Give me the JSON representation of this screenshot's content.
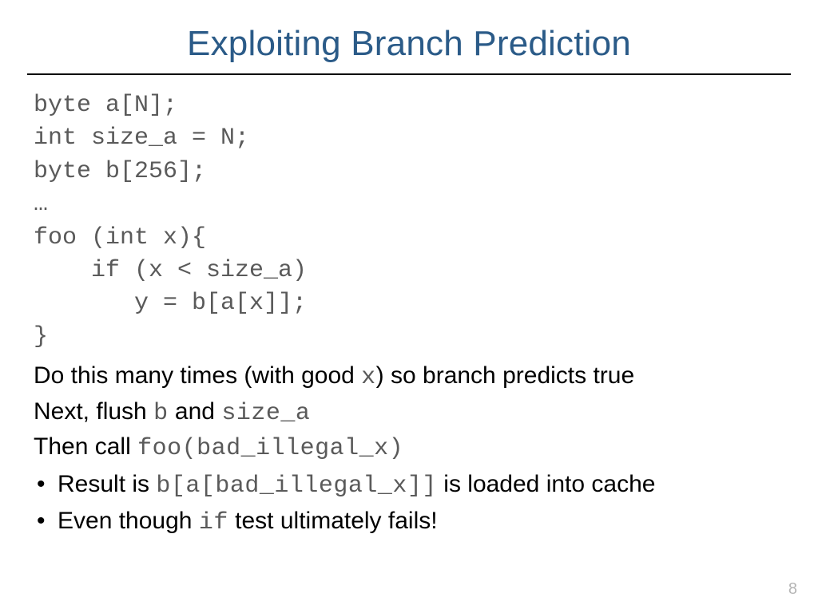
{
  "title": "Exploiting Branch Prediction",
  "code": "byte a[N];\nint size_a = N;\nbyte b[256];\n…\nfoo (int x){\n    if (x < size_a)\n       y = b[a[x]];\n}",
  "lines": {
    "l1_a": "Do this many times (with good ",
    "l1_code": "x",
    "l1_b": ") so branch predicts true",
    "l2_a": "Next, flush ",
    "l2_code1": "b",
    "l2_mid": " and ",
    "l2_code2": "size_a",
    "l3_a": "Then call ",
    "l3_code": "foo(bad_illegal_x)"
  },
  "bullets": {
    "b1_a": "Result is ",
    "b1_code": "b[a[bad_illegal_x]]",
    "b1_b": " is loaded into cache",
    "b2_a": "Even though ",
    "b2_code": "if",
    "b2_b": " test ultimately fails!"
  },
  "page": "8"
}
